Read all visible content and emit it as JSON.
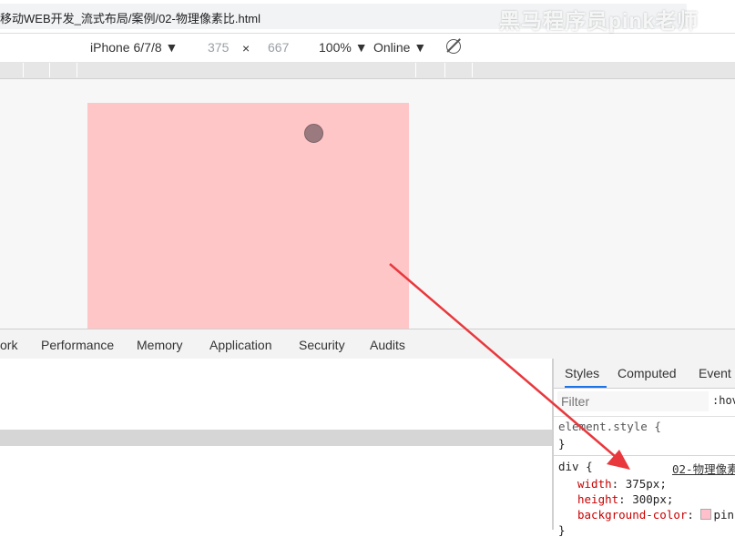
{
  "address_bar": {
    "path": "移动WEB开发_流式布局/案例/02-物理像素比.html"
  },
  "watermark": "黑马程序员pink老师",
  "device_toolbar": {
    "device": "iPhone 6/7/8 ▼",
    "width": "375",
    "times": "×",
    "height": "667",
    "zoom": "100% ▼",
    "throttle": "Online ▼",
    "rotate_icon": "rotate-icon"
  },
  "devtools_tabs": [
    "ork",
    "Performance",
    "Memory",
    "Application",
    "Security",
    "Audits"
  ],
  "styles_pane": {
    "tabs": [
      "Styles",
      "Computed",
      "Event L"
    ],
    "active_tab": "Styles",
    "filter_placeholder": "Filter",
    "hov": ":hov",
    "element_style_open": "element.style {",
    "element_style_close": "}",
    "rule_selector": "div {",
    "rule_source": "02-物理像素",
    "declarations": [
      {
        "prop": "width",
        "value": "375px;"
      },
      {
        "prop": "height",
        "value": "300px;"
      },
      {
        "prop": "background-color",
        "value": "pin"
      }
    ],
    "rule_close": "}"
  },
  "colors": {
    "preview_box": "#ffc6c8",
    "arrow": "#e8383d",
    "active_tab_underline": "#1a73e8"
  }
}
